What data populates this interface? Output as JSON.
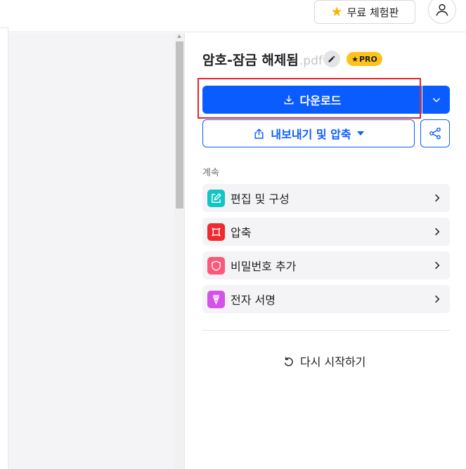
{
  "topbar": {
    "trial_label": "무료 체험판",
    "trial_icon": "star-icon",
    "avatar_icon": "user-icon"
  },
  "file": {
    "name": "암호-잠금 해제됨",
    "ext": ".pdf",
    "pro_badge": "PRO"
  },
  "actions": {
    "download_label": "다운로드",
    "export_label": "내보내기 및 압축",
    "share_icon": "share-icon"
  },
  "continue": {
    "label": "계속",
    "tools": [
      {
        "label": "편집 및 구성",
        "icon": "edit-organize-icon",
        "color": "#13c4c4"
      },
      {
        "label": "압축",
        "icon": "compress-icon",
        "color": "#ed2b31"
      },
      {
        "label": "비밀번호 추가",
        "icon": "shield-lock-icon",
        "color": "#ff5777"
      },
      {
        "label": "전자 서명",
        "icon": "sign-pen-icon",
        "color": "#d552e6"
      }
    ]
  },
  "restart_label": "다시 시작하기",
  "colors": {
    "primary": "#0b5cff",
    "pro": "#ffc21a",
    "highlight": "#e3242b"
  }
}
